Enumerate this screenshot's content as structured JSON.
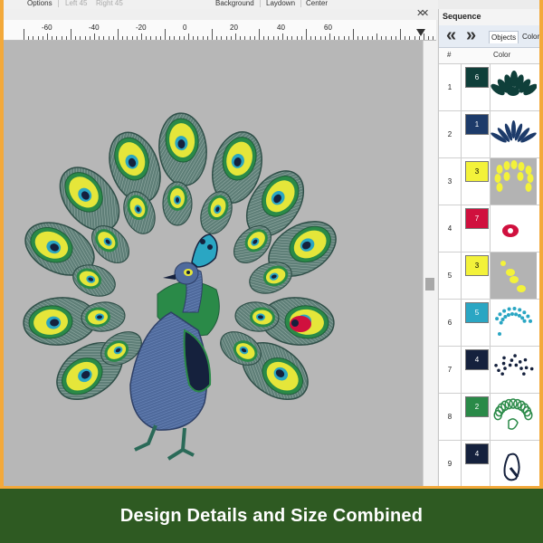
{
  "toolbar": {
    "options_label": "Options",
    "left_label": "Left 45",
    "right_label": "Right 45",
    "background_label": "Background",
    "laydown_label": "Laydown",
    "center_label": "Center"
  },
  "ruler": {
    "labels": [
      "-60",
      "-40",
      "-20",
      "0",
      "20",
      "40",
      "60"
    ]
  },
  "panel": {
    "title": "Sequence",
    "tabs": [
      "Objects",
      "Colors"
    ],
    "active_tab": "Objects",
    "col_num": "#",
    "col_color": "Color"
  },
  "sequence": [
    {
      "num": "1",
      "color_num": "6",
      "color": "#0f3f3a",
      "text_color": "#ffffff",
      "preview": "dark-green-feathers"
    },
    {
      "num": "2",
      "color_num": "1",
      "color": "#1d3b6a",
      "text_color": "#ffffff",
      "preview": "navy-feathers"
    },
    {
      "num": "3",
      "color_num": "3",
      "color": "#f3f23a",
      "text_color": "#000000",
      "preview": "yellow-eyes"
    },
    {
      "num": "4",
      "color_num": "7",
      "color": "#d0103e",
      "text_color": "#ffffff",
      "preview": "red-eye"
    },
    {
      "num": "5",
      "color_num": "3",
      "color": "#f3f23a",
      "text_color": "#000000",
      "preview": "yellow-spots"
    },
    {
      "num": "6",
      "color_num": "5",
      "color": "#2aa6c3",
      "text_color": "#ffffff",
      "preview": "teal-dots"
    },
    {
      "num": "7",
      "color_num": "4",
      "color": "#15213d",
      "text_color": "#ffffff",
      "preview": "black-dots"
    },
    {
      "num": "8",
      "color_num": "2",
      "color": "#2a8a48",
      "text_color": "#ffffff",
      "preview": "green-outline"
    },
    {
      "num": "9",
      "color_num": "4",
      "color": "#15213d",
      "text_color": "#ffffff",
      "preview": "body-outline"
    }
  ],
  "banner": {
    "text": "Design Details and Size Combined"
  },
  "colors": {
    "accent_orange": "#f3a93a",
    "banner_green": "#2e5a22",
    "canvas_gray": "#b7b7b7"
  }
}
